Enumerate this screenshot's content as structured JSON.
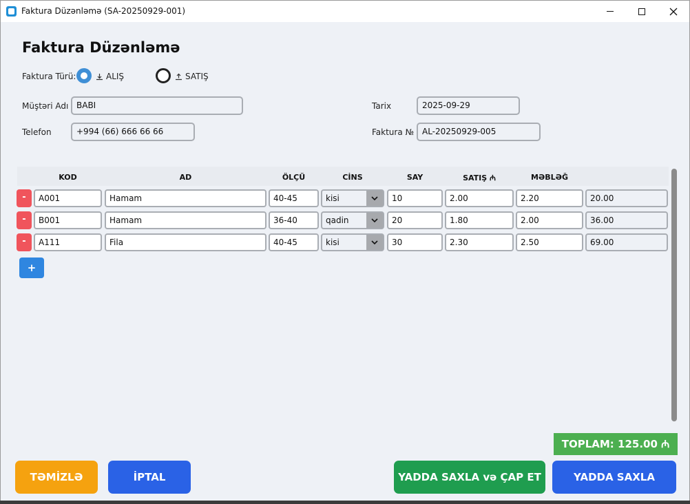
{
  "window": {
    "title": "Faktura Düzənləmə (SA-20250929-001)"
  },
  "heading": "Faktura Düzənləmə",
  "invoice_type": {
    "label": "Faktura Türü:",
    "options": [
      {
        "label": "ALIŞ",
        "selected": true
      },
      {
        "label": "SATIŞ",
        "selected": false
      }
    ]
  },
  "customer": {
    "name_label": "Müştəri Adı",
    "name_value": "BABI",
    "phone_label": "Telefon",
    "phone_value": "+994 (66) 666 66 66"
  },
  "meta": {
    "date_label": "Tarix",
    "date_value": "2025-09-29",
    "number_label": "Faktura №",
    "number_value": "AL-20250929-005"
  },
  "table": {
    "headers": [
      "KOD",
      "AD",
      "ÖLÇÜ",
      "CİNS",
      "SAY",
      "SATIŞ ₼",
      "MƏBLƏĞ"
    ],
    "rows": [
      {
        "kod": "A001",
        "ad": "Hamam",
        "olcu": "40-45",
        "cins": "kisi",
        "say": "10",
        "alis": "2.00",
        "satis": "2.20",
        "mebleg": "20.00"
      },
      {
        "kod": "B001",
        "ad": "Hamam",
        "olcu": "36-40",
        "cins": "qadin",
        "say": "20",
        "alis": "1.80",
        "satis": "2.00",
        "mebleg": "36.00"
      },
      {
        "kod": "A111",
        "ad": "Fila",
        "olcu": "40-45",
        "cins": "kisi",
        "say": "30",
        "alis": "2.30",
        "satis": "2.50",
        "mebleg": "69.00"
      }
    ],
    "delete_label": "-",
    "add_label": "+"
  },
  "total": "TOPLAM: 125.00 ₼",
  "buttons": {
    "clear": "TƏMİZLƏ",
    "cancel": "İPTAL",
    "save_print": "YADDA SAXLA və ÇAP ET",
    "save": "YADDA SAXLA"
  },
  "colors": {
    "accent": "#2a62e6",
    "success": "#4caf50",
    "warning": "#f5a20f",
    "danger": "#f0545c"
  }
}
